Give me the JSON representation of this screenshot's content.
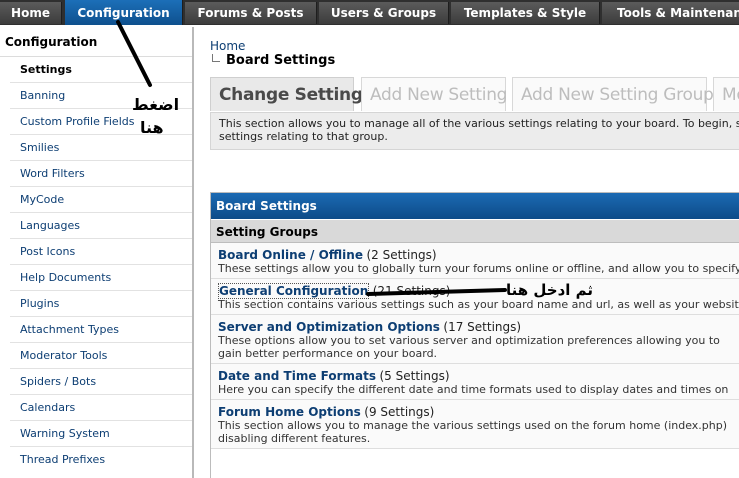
{
  "topnav": {
    "tabs": [
      {
        "label": "Home"
      },
      {
        "label": "Configuration"
      },
      {
        "label": "Forums & Posts"
      },
      {
        "label": "Users & Groups"
      },
      {
        "label": "Templates & Style"
      },
      {
        "label": "Tools & Maintenance"
      }
    ]
  },
  "sidebar": {
    "heading": "Configuration",
    "items": [
      {
        "label": "Settings"
      },
      {
        "label": "Banning"
      },
      {
        "label": "Custom Profile Fields"
      },
      {
        "label": "Smilies"
      },
      {
        "label": "Word Filters"
      },
      {
        "label": "MyCode"
      },
      {
        "label": "Languages"
      },
      {
        "label": "Post Icons"
      },
      {
        "label": "Help Documents"
      },
      {
        "label": "Plugins"
      },
      {
        "label": "Attachment Types"
      },
      {
        "label": "Moderator Tools"
      },
      {
        "label": "Spiders / Bots"
      },
      {
        "label": "Calendars"
      },
      {
        "label": "Warning System"
      },
      {
        "label": "Thread Prefixes"
      }
    ]
  },
  "breadcrumb": {
    "home": "Home",
    "current": "Board Settings"
  },
  "subtabs": [
    {
      "label": "Change Settings"
    },
    {
      "label": "Add New Setting"
    },
    {
      "label": "Add New Setting Group"
    },
    {
      "label": "Modify Settings"
    }
  ],
  "description": {
    "line1": "This section allows you to manage all of the various settings relating to your board. To begin, select a group below to manage",
    "line2": "settings relating to that group."
  },
  "panel": {
    "title": "Board Settings",
    "subtitle": "Setting Groups",
    "groups": [
      {
        "title": "Board Online / Offline",
        "count": "(2 Settings)",
        "desc": [
          "These settings allow you to globally turn your forums online or offline, and allow you to specify"
        ]
      },
      {
        "title": "General Configuration",
        "count": "(21 Settings)",
        "desc": [
          "This section contains various settings such as your board name and url, as well as your website name"
        ]
      },
      {
        "title": "Server and Optimization Options",
        "count": "(17 Settings)",
        "desc": [
          "These options allow you to set various server and optimization preferences allowing you to",
          "gain better performance on your board."
        ]
      },
      {
        "title": "Date and Time Formats",
        "count": "(5 Settings)",
        "desc": [
          "Here you can specify the different date and time formats used to display dates and times on"
        ]
      },
      {
        "title": "Forum Home Options",
        "count": "(9 Settings)",
        "desc": [
          "This section allows you to manage the various settings used on the forum home (index.php)",
          "disabling different features."
        ]
      }
    ]
  },
  "annotations": {
    "click_here_line1": "اضغط",
    "click_here_line2": "هنا",
    "then_enter_here": "ثم ادخل هنا"
  }
}
